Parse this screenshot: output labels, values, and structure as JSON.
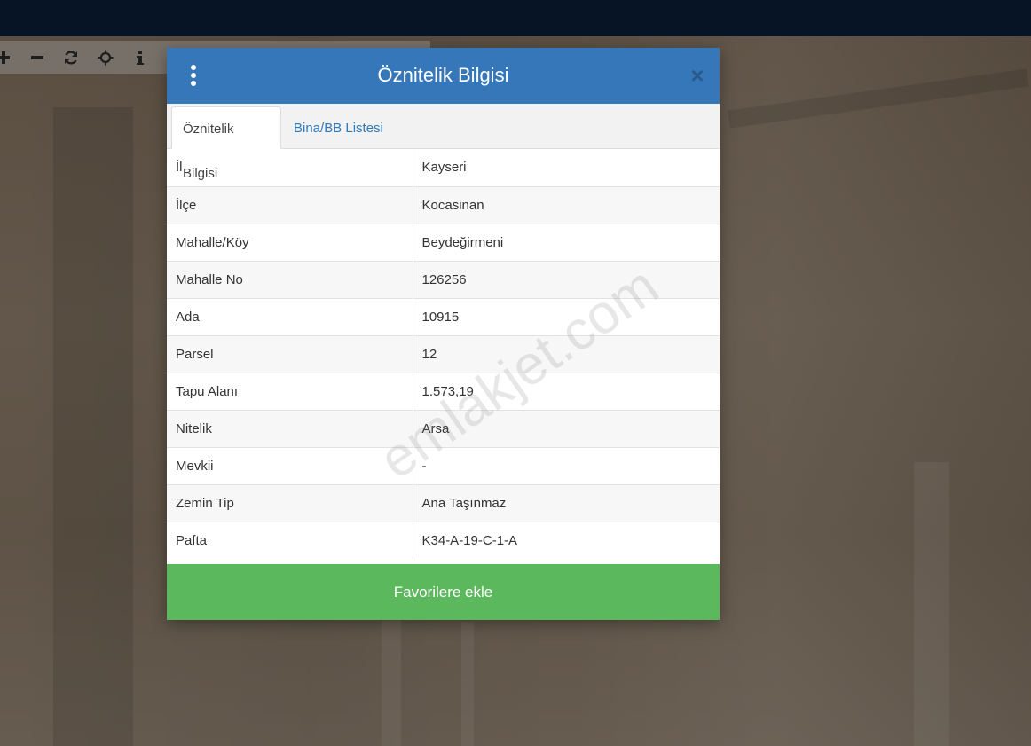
{
  "toolbar": {
    "buttons": [
      {
        "name": "zoom-in-button",
        "icon": "plus-icon"
      },
      {
        "name": "zoom-out-button",
        "icon": "minus-icon"
      },
      {
        "name": "refresh-button",
        "icon": "refresh-icon"
      },
      {
        "name": "locate-button",
        "icon": "crosshair-icon"
      },
      {
        "name": "info-button",
        "icon": "info-icon"
      }
    ]
  },
  "modal": {
    "title": "Öznitelik Bilgisi",
    "close_glyph": "×",
    "tabs": [
      {
        "label": "Öznitelik Bilgisi",
        "active": true
      },
      {
        "label": "Bina/BB Listesi",
        "active": false
      }
    ],
    "rows": [
      {
        "key": "İl",
        "value": "Kayseri"
      },
      {
        "key": "İlçe",
        "value": "Kocasinan"
      },
      {
        "key": "Mahalle/Köy",
        "value": "Beydeğirmeni"
      },
      {
        "key": "Mahalle No",
        "value": "126256"
      },
      {
        "key": "Ada",
        "value": "10915"
      },
      {
        "key": "Parsel",
        "value": "12"
      },
      {
        "key": "Tapu Alanı",
        "value": "1.573,19"
      },
      {
        "key": "Nitelik",
        "value": "Arsa"
      },
      {
        "key": "Mevkii",
        "value": "-"
      },
      {
        "key": "Zemin Tip",
        "value": "Ana Taşınmaz"
      },
      {
        "key": "Pafta",
        "value": "K34-A-19-C-1-A"
      }
    ],
    "favorite_button": "Favorilere ekle"
  },
  "watermark": "emlakjet.com",
  "colors": {
    "header": "#3577b9",
    "topbar": "#061425",
    "favorite": "#5cb85c",
    "tab_link": "#2f7bbf"
  }
}
